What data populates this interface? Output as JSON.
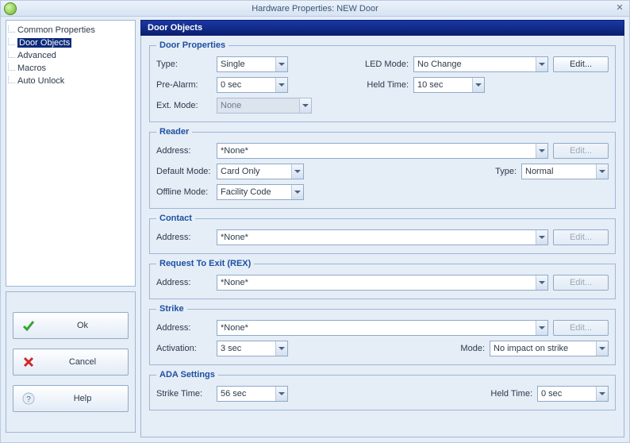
{
  "window": {
    "title": "Hardware Properties: NEW Door"
  },
  "nav": {
    "items": [
      {
        "label": "Common Properties"
      },
      {
        "label": "Door Objects"
      },
      {
        "label": "Advanced"
      },
      {
        "label": "Macros"
      },
      {
        "label": "Auto Unlock"
      }
    ],
    "selected_index": 1
  },
  "buttons": {
    "ok": "Ok",
    "cancel": "Cancel",
    "help": "Help",
    "edit": "Edit..."
  },
  "page": {
    "title": "Door Objects",
    "door_properties": {
      "legend": "Door Properties",
      "type_label": "Type:",
      "type_value": "Single",
      "led_mode_label": "LED Mode:",
      "led_mode_value": "No Change",
      "pre_alarm_label": "Pre-Alarm:",
      "pre_alarm_value": "0 sec",
      "held_time_label": "Held Time:",
      "held_time_value": "10 sec",
      "ext_mode_label": "Ext. Mode:",
      "ext_mode_value": "None"
    },
    "reader": {
      "legend": "Reader",
      "address_label": "Address:",
      "address_value": "*None*",
      "default_mode_label": "Default Mode:",
      "default_mode_value": "Card Only",
      "type_label": "Type:",
      "type_value": "Normal",
      "offline_mode_label": "Offline Mode:",
      "offline_mode_value": "Facility Code"
    },
    "contact": {
      "legend": "Contact",
      "address_label": "Address:",
      "address_value": "*None*"
    },
    "rex": {
      "legend": "Request To Exit (REX)",
      "address_label": "Address:",
      "address_value": "*None*"
    },
    "strike": {
      "legend": "Strike",
      "address_label": "Address:",
      "address_value": "*None*",
      "activation_label": "Activation:",
      "activation_value": "3 sec",
      "mode_label": "Mode:",
      "mode_value": "No impact on strike"
    },
    "ada": {
      "legend": "ADA Settings",
      "strike_time_label": "Strike Time:",
      "strike_time_value": "56 sec",
      "held_time_label": "Held Time:",
      "held_time_value": "0 sec"
    }
  }
}
